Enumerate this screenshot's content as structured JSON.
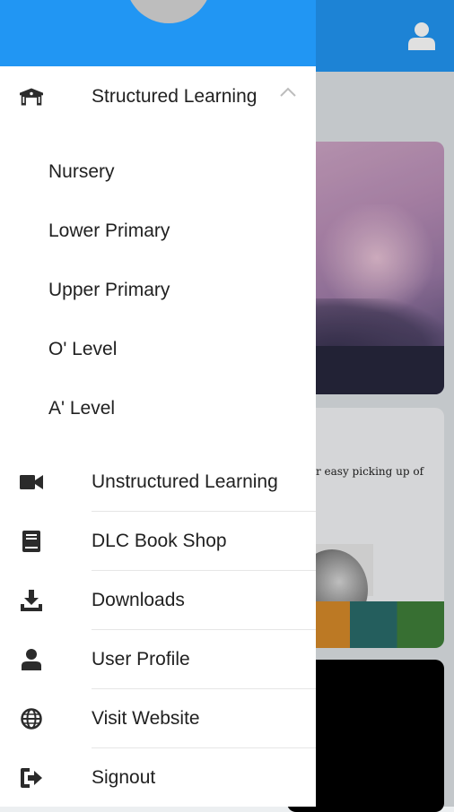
{
  "colors": {
    "primary": "#2196f3",
    "drawer_bg": "#ffffff",
    "text": "#212121",
    "icon": "#2b2b2b"
  },
  "drawer": {
    "expanded_section": {
      "label": "Structured Learning",
      "icon": "school-icon",
      "sub_items": [
        {
          "label": "Nursery"
        },
        {
          "label": "Lower Primary"
        },
        {
          "label": "Upper Primary"
        },
        {
          "label": "O' Level"
        },
        {
          "label": "A' Level"
        }
      ]
    },
    "items": [
      {
        "label": "Unstructured Learning",
        "icon": "video-camera-icon"
      },
      {
        "label": "DLC Book Shop",
        "icon": "book-icon"
      },
      {
        "label": "Downloads",
        "icon": "download-icon"
      },
      {
        "label": "User Profile",
        "icon": "person-icon"
      },
      {
        "label": "Visit Website",
        "icon": "globe-icon"
      },
      {
        "label": "Signout",
        "icon": "signout-icon"
      }
    ]
  },
  "background": {
    "card_text": "r easy picking up of",
    "header_icon": "account-icon"
  }
}
